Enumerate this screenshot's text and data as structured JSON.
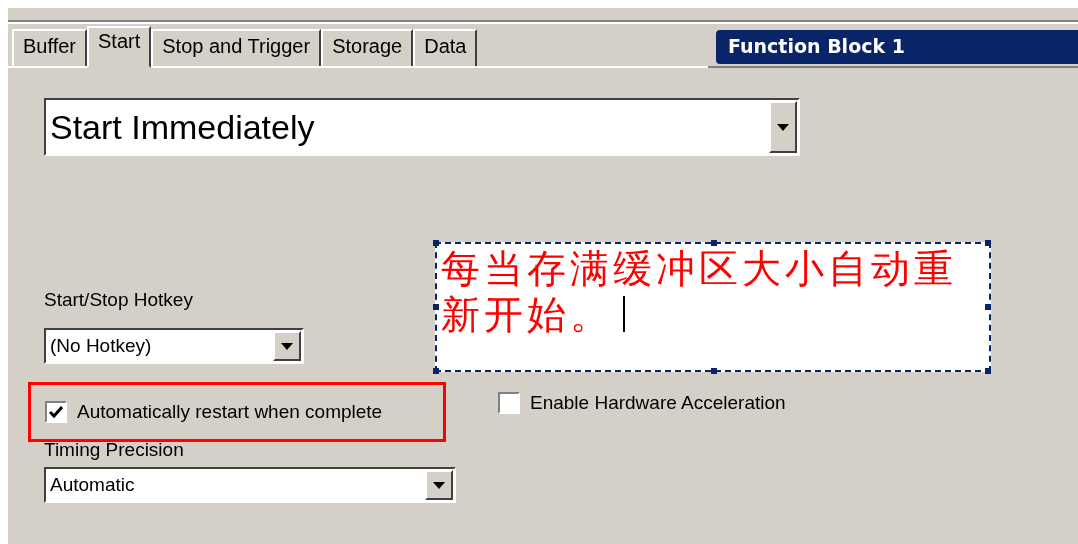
{
  "tabs": [
    {
      "label": "Buffer",
      "selected": false
    },
    {
      "label": "Start",
      "selected": true
    },
    {
      "label": "Stop and Trigger",
      "selected": false
    },
    {
      "label": "Storage",
      "selected": false
    },
    {
      "label": "Data",
      "selected": false
    }
  ],
  "panel_title": "Function Block 1",
  "start_mode": {
    "value": "Start Immediately"
  },
  "hotkey": {
    "label": "Start/Stop Hotkey",
    "value": "(No Hotkey)"
  },
  "options": [
    {
      "label": "Automatically restart when complete",
      "checked": true,
      "highlighted": true
    },
    {
      "label": "Enable Hardware Acceleration",
      "checked": false,
      "highlighted": false
    }
  ],
  "timing_precision": {
    "label": "Timing Precision",
    "value": "Automatic"
  },
  "annotation": {
    "text": "每当存满缓冲区大小自动重新开始。"
  }
}
